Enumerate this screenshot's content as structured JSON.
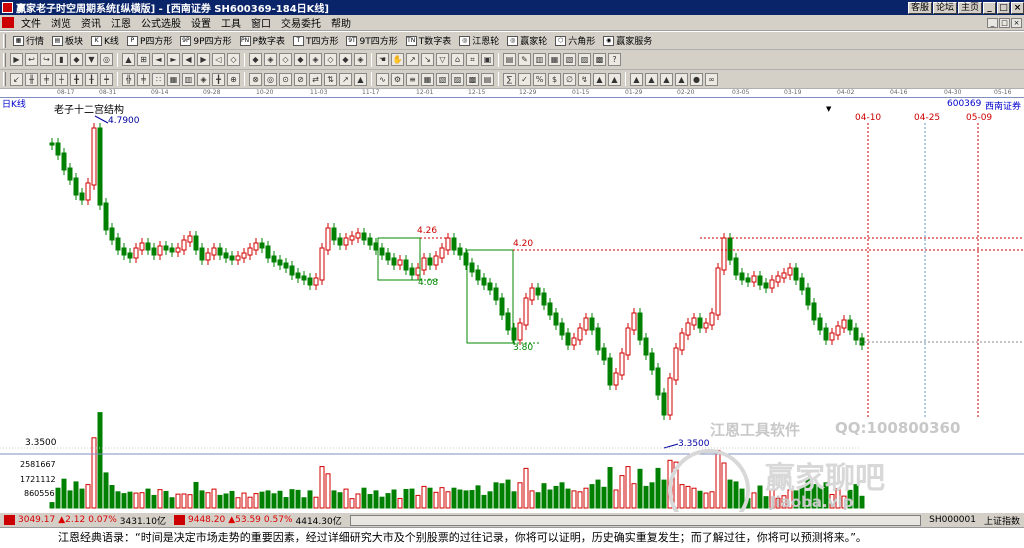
{
  "window": {
    "title": "赢家老子时空周期系统[纵横版] - [西南证券  SH600369-184日K线]",
    "right_buttons": [
      "客服",
      "论坛",
      "主页"
    ],
    "controls": [
      "_",
      "□",
      "×"
    ]
  },
  "menu": [
    "文件",
    "浏览",
    "资讯",
    "江恩",
    "公式选股",
    "设置",
    "工具",
    "窗口",
    "交易委托",
    "帮助"
  ],
  "toolbar1": [
    {
      "icon": "quote-icon",
      "glyph": "▦",
      "label": "行情"
    },
    {
      "icon": "sector-icon",
      "glyph": "▤",
      "label": "板块"
    },
    {
      "icon": "kline-icon",
      "glyph": "K",
      "label": "K线"
    },
    {
      "icon": "p-square-icon",
      "glyph": "P",
      "label": "P四方形"
    },
    {
      "icon": "9p-square-icon",
      "glyph": "9P",
      "label": "9P四方形"
    },
    {
      "icon": "pn-table-icon",
      "glyph": "PN",
      "label": "P数字表"
    },
    {
      "icon": "t-square-icon",
      "glyph": "T",
      "label": "T四方形"
    },
    {
      "icon": "9t-square-icon",
      "glyph": "9T",
      "label": "9T四方形"
    },
    {
      "icon": "tn-table-icon",
      "glyph": "TN",
      "label": "T数字表"
    },
    {
      "icon": "gann-wheel-icon",
      "glyph": "◎",
      "label": "江恩轮"
    },
    {
      "icon": "winner-wheel-icon",
      "glyph": "◎",
      "label": "赢家轮"
    },
    {
      "icon": "hexagon-icon",
      "glyph": "⬡",
      "label": "六角形"
    },
    {
      "icon": "service-icon",
      "glyph": "◉",
      "label": "赢家服务"
    }
  ],
  "toolbar2": [
    "▶",
    "↩",
    "↪",
    "▮",
    "◆",
    "▼",
    "◎",
    "▲",
    "⊞",
    "◄",
    "►",
    "◀",
    "▶",
    "◁",
    "◇",
    "◆",
    "◈",
    "◇",
    "◆",
    "◈",
    "◇",
    "◆",
    "◈",
    "☚",
    "✋",
    "↗",
    "↘",
    "▽",
    "⌂",
    "⌗",
    "▣",
    "▤",
    "✎",
    "▥",
    "▦",
    "▧",
    "▨",
    "▩",
    "?"
  ],
  "toolbar3": [
    "↙",
    "╫",
    "╪",
    "┼",
    "╋",
    "╂",
    "┿",
    "╬",
    "╪",
    "∷",
    "▦",
    "▥",
    "◈",
    "╋",
    "⊕",
    "⊗",
    "◎",
    "⊙",
    "⊘",
    "⇄",
    "⇅",
    "↗",
    "▲",
    "∿",
    "⚙",
    "≡",
    "▦",
    "▧",
    "▨",
    "▩",
    "▤",
    "∑",
    "✓",
    "%",
    "$",
    "∅",
    "↯",
    "▲",
    "▲",
    "▲",
    "▲",
    "▲",
    "▲",
    "●",
    "∞"
  ],
  "dates": [
    "08-17",
    "08-31",
    "09-14",
    "09-28",
    "10-20",
    "11-03",
    "11-17",
    "12-01",
    "12-15",
    "12-29",
    "01-15",
    "01-29",
    "02-20",
    "03-05",
    "03-19",
    "04-02",
    "04-16",
    "04-30",
    "05-16"
  ],
  "chart": {
    "period_label": "日K线",
    "pattern_name": "老子十二宫结构",
    "stock_code": "600369",
    "stock_name": "西南证券",
    "high_label": "4.7900",
    "low_label": "3.3500",
    "box_labels": [
      "4.26",
      "4.08",
      "4.20",
      "3.80"
    ],
    "future_dates": [
      "04-10",
      "04-25",
      "05-09"
    ],
    "y_axis_price": "3.3500",
    "volume_axis": [
      "2581667",
      "1721112",
      "860556"
    ],
    "watermark_software": "江恩工具软件",
    "watermark_qq": "QQ:100800360",
    "watermark_site": "赢家聊吧",
    "watermark_sub": "Jiaoba.vip"
  },
  "chart_data": {
    "type": "candlestick",
    "price_range": [
      3.35,
      4.79
    ],
    "high": 4.79,
    "low": 3.35,
    "boxes": [
      {
        "top": 4.26,
        "bottom": 4.08
      },
      {
        "top": 4.2,
        "bottom": 3.8
      }
    ]
  },
  "status": {
    "sh_index": "3049.17",
    "sh_change": "▲2.12",
    "sh_pct": "0.07%",
    "sh_amount": "3431.10亿",
    "sz_index": "9448.20",
    "sz_change": "▲53.59",
    "sz_pct": "0.57%",
    "sz_amount": "4414.30亿",
    "code": "SH000001",
    "name": "上证指数"
  },
  "quote": "江恩经典语录：“时间是决定市场走势的重要因素，经过详细研究大市及个别股票的过往记录，你将可以证明，历史确实重复发生；而了解过往，你将可以预测将来。”。",
  "colors": {
    "up": "#d00000",
    "down": "#008000",
    "title_bg": "#0a246a",
    "panel_bg": "#d4d0c8"
  }
}
